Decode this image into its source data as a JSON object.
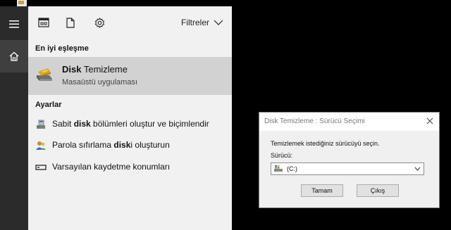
{
  "rail": {
    "menu_icon": "hamburger-icon",
    "home_icon": "home-icon"
  },
  "topbar": {
    "icons": [
      "apps-icon",
      "document-icon",
      "settings-gear-icon"
    ],
    "filter_label": "Filtreler"
  },
  "best_match": {
    "section_title": "En iyi eşleşme",
    "name_bold": "Disk",
    "name_rest": " Temizleme",
    "subtitle": "Masaüstü uygulaması",
    "icon": "disk-cleanup-icon"
  },
  "settings": {
    "section_title": "Ayarlar",
    "items": [
      {
        "pre": "Sabit ",
        "bold": "disk",
        "post": " bölümleri oluştur ve biçimlendir",
        "icon": "disk-management-icon"
      },
      {
        "pre": "Parola sıfırlama ",
        "bold": "disk",
        "post": "i oluşturun",
        "icon": "users-icon"
      },
      {
        "pre": "Varsayılan kaydetme konumları",
        "bold": "",
        "post": "",
        "icon": "drive-icon"
      }
    ]
  },
  "dialog": {
    "title": "Disk Temizleme : Sürücü Seçimi",
    "instruction": "Temizlemek istediğiniz sürücüyü seçin.",
    "drive_label": "Sürücü:",
    "drive_value": "(C:)",
    "ok_label": "Tamam",
    "exit_label": "Çıkış"
  },
  "colors": {
    "rail": "#2b2b2b",
    "panel": "#f1f1f1",
    "highlight": "#d2d2d2",
    "desktop": "#000000"
  }
}
